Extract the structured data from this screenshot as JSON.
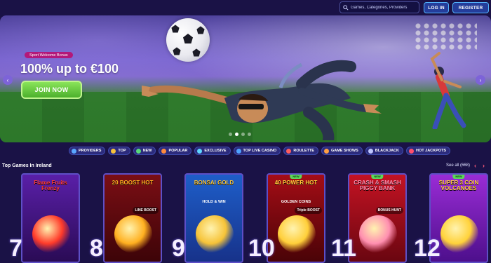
{
  "header": {
    "search_placeholder": "Games, Categories, Providers",
    "login_label": "LOG IN",
    "register_label": "REGISTER"
  },
  "hero": {
    "tag": "Sport Welcome Bonus",
    "title": "100% up to €100",
    "cta_label": "JOIN NOW",
    "slides": 4,
    "active_slide": 2
  },
  "categories": [
    {
      "label": "PROVIDERS",
      "icon": "providers-icon",
      "color": "#5aa7ff"
    },
    {
      "label": "TOP",
      "icon": "crown-icon",
      "color": "#f7c23b"
    },
    {
      "label": "NEW",
      "icon": "new-icon",
      "color": "#58d97a"
    },
    {
      "label": "POPULAR",
      "icon": "popular-icon",
      "color": "#ff8a3d"
    },
    {
      "label": "EXCLUSIVE",
      "icon": "diamond-icon",
      "color": "#5fd4ff"
    },
    {
      "label": "TOP LIVE CASINO",
      "icon": "live-casino-icon",
      "color": "#4fa3ff"
    },
    {
      "label": "ROULETTE",
      "icon": "roulette-icon",
      "color": "#ff5e5e"
    },
    {
      "label": "GAME SHOWS",
      "icon": "game-shows-icon",
      "color": "#ff9f43"
    },
    {
      "label": "BLACKJACK",
      "icon": "blackjack-icon",
      "color": "#bfc6ff"
    },
    {
      "label": "HOT JACKPOTS",
      "icon": "jackpot-icon",
      "color": "#ff4f6d"
    }
  ],
  "section": {
    "title": "Top Games In Ireland",
    "see_all": "See all (668)",
    "prev_icon": "‹",
    "next_icon": "›"
  },
  "games": [
    {
      "rank": "7",
      "title": "Flame Fruits Frenzy",
      "bg_top": "#5a1fa8",
      "bg_bottom": "#2a0b55",
      "accent": "#ff3b2a",
      "is_new": false
    },
    {
      "rank": "8",
      "title": "20 BOOST HOT",
      "badge": "LINE BOOST",
      "bg_top": "#7a0e14",
      "bg_bottom": "#3d0408",
      "accent": "#ffb020",
      "is_new": false
    },
    {
      "rank": "9",
      "title": "BONSAI GOLD",
      "subtitle": "HOLD & WIN",
      "bg_top": "#1e5ec9",
      "bg_bottom": "#17328a",
      "accent": "#f6c338",
      "is_new": false
    },
    {
      "rank": "10",
      "title": "40 POWER HOT",
      "subtitle": "GOLDEN COINS",
      "badge": "Triple BOOST",
      "bg_top": "#a40d16",
      "bg_bottom": "#4a0307",
      "accent": "#ffcf3a",
      "is_new": true,
      "new_label": "NEW"
    },
    {
      "rank": "11",
      "title": "CRASH & SMASH PIGGY BANK",
      "badge": "BONUS HUNT",
      "bg_top": "#c41323",
      "bg_bottom": "#6a0610",
      "accent": "#ff8fb0",
      "is_new": true,
      "new_label": "NEW"
    },
    {
      "rank": "12",
      "title": "SUPER 3 COIN VOLCANOES",
      "bg_top": "#9a2cd6",
      "bg_bottom": "#4d0f8c",
      "accent": "#ffd23a",
      "is_new": true,
      "new_label": "NEW"
    }
  ]
}
